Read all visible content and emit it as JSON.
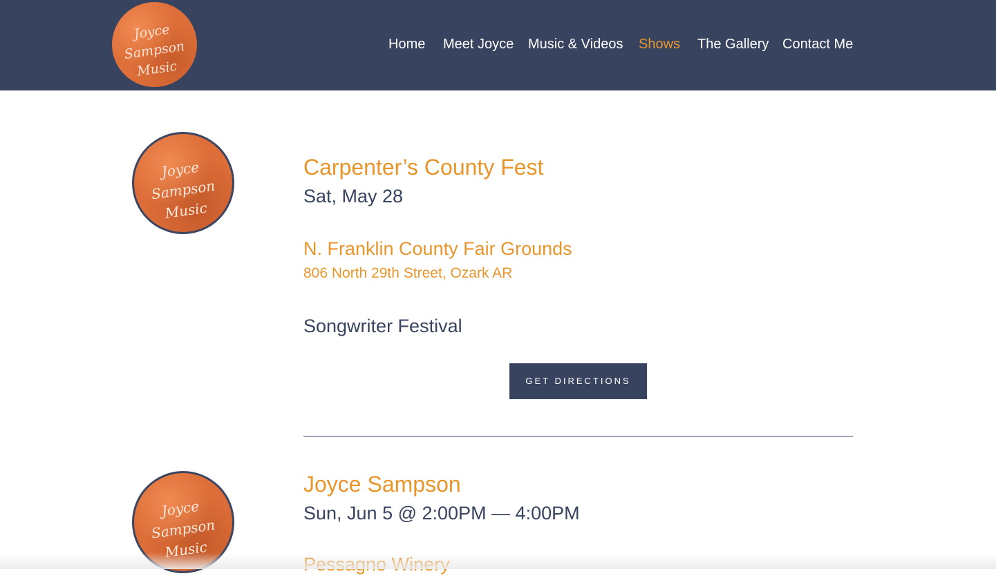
{
  "header": {
    "logo_text_line1": "Joyce Sampson",
    "logo_text_line2": "Music",
    "nav": [
      {
        "label": "Home"
      },
      {
        "label": "Meet Joyce"
      },
      {
        "label": "Music & Videos"
      },
      {
        "label": "Shows",
        "active": true
      },
      {
        "label": "The Gallery"
      },
      {
        "label": "Contact Me"
      }
    ],
    "colors": {
      "background": "#38445f",
      "active": "#e8962b"
    }
  },
  "events": [
    {
      "thumb_text_line1": "Joyce Sampson",
      "thumb_text_line2": "Music",
      "title": "Carpenter’s County Fest",
      "date": "Sat, May 28",
      "venue": "N. Franklin County Fair Grounds",
      "address": "806 North 29th Street, Ozark AR",
      "description": "Songwriter Festival",
      "button_label": "GET DIRECTIONS"
    },
    {
      "thumb_text_line1": "Joyce Sampson",
      "thumb_text_line2": "Music",
      "title": "Joyce Sampson",
      "date": "Sun, Jun 5 @ 2:00PM — 4:00PM",
      "venue": "Pessagno Winery"
    }
  ],
  "colors": {
    "accent": "#e8962b",
    "navy": "#38445f"
  }
}
